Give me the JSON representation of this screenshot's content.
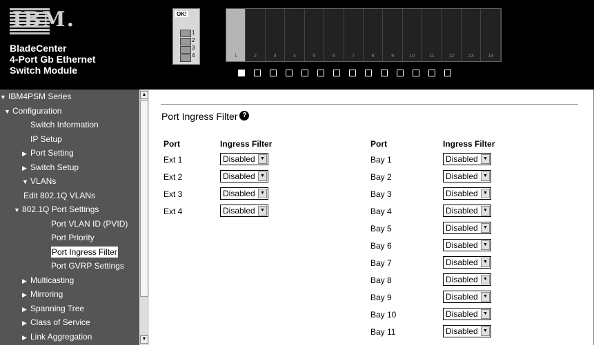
{
  "header": {
    "logo": "IBM.",
    "brand_lines": [
      "BladeCenter",
      "4-Port Gb Ethernet",
      "Switch Module"
    ],
    "module_ok": "OK!",
    "module_ports": [
      "1",
      "2",
      "3",
      "4"
    ],
    "bays": [
      "1",
      "2",
      "3",
      "4",
      "5",
      "6",
      "7",
      "8",
      "9",
      "10",
      "11",
      "12",
      "13",
      "14"
    ],
    "active_bay": 1
  },
  "sidebar": {
    "items": [
      {
        "label": "IBM4PSM Series",
        "level": 0,
        "arrow": "down"
      },
      {
        "label": "Configuration",
        "level": 1,
        "arrow": "down"
      },
      {
        "label": "Switch Information",
        "level": 2,
        "arrow": ""
      },
      {
        "label": "IP Setup",
        "level": 2,
        "arrow": ""
      },
      {
        "label": "Port Setting",
        "level": 2,
        "arrow": "right"
      },
      {
        "label": "Switch Setup",
        "level": 2,
        "arrow": "right"
      },
      {
        "label": "VLANs",
        "level": 2,
        "arrow": "down"
      },
      {
        "label": "Edit 802.1Q VLANs",
        "level": 3,
        "arrow": ""
      },
      {
        "label": "802.1Q Port Settings",
        "level": 3,
        "arrow": "down"
      },
      {
        "label": "Port VLAN ID (PVID)",
        "level": 4,
        "arrow": ""
      },
      {
        "label": "Port Priority",
        "level": 4,
        "arrow": ""
      },
      {
        "label": "Port Ingress Filter",
        "level": 4,
        "arrow": "",
        "selected": true
      },
      {
        "label": "Port GVRP Settings",
        "level": 4,
        "arrow": ""
      },
      {
        "label": "Multicasting",
        "level": 2,
        "arrow": "right"
      },
      {
        "label": "Mirroring",
        "level": 2,
        "arrow": "right"
      },
      {
        "label": "Spanning Tree",
        "level": 2,
        "arrow": "right"
      },
      {
        "label": "Class of Service",
        "level": 2,
        "arrow": "right"
      },
      {
        "label": "Link Aggregation",
        "level": 2,
        "arrow": "right"
      }
    ]
  },
  "main": {
    "title": "Port Ingress Filter",
    "help_icon": "?",
    "col_port": "Port",
    "col_filter": "Ingress Filter",
    "ext_ports": [
      {
        "port": "Ext 1",
        "value": "Disabled"
      },
      {
        "port": "Ext 2",
        "value": "Disabled"
      },
      {
        "port": "Ext 3",
        "value": "Disabled"
      },
      {
        "port": "Ext 4",
        "value": "Disabled"
      }
    ],
    "bay_ports": [
      {
        "port": "Bay 1",
        "value": "Disabled"
      },
      {
        "port": "Bay 2",
        "value": "Disabled"
      },
      {
        "port": "Bay 3",
        "value": "Disabled"
      },
      {
        "port": "Bay 4",
        "value": "Disabled"
      },
      {
        "port": "Bay 5",
        "value": "Disabled"
      },
      {
        "port": "Bay 6",
        "value": "Disabled"
      },
      {
        "port": "Bay 7",
        "value": "Disabled"
      },
      {
        "port": "Bay 8",
        "value": "Disabled"
      },
      {
        "port": "Bay 9",
        "value": "Disabled"
      },
      {
        "port": "Bay 10",
        "value": "Disabled"
      },
      {
        "port": "Bay 11",
        "value": "Disabled"
      }
    ]
  },
  "icons": {
    "expand": "triangle-down",
    "collapse": "triangle-right",
    "help": "question-circle-icon"
  }
}
